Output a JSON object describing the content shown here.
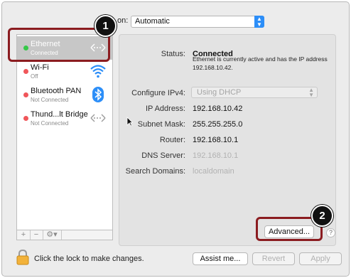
{
  "location": {
    "label_fragment": "on:",
    "value": "Automatic"
  },
  "sidebar": {
    "items": [
      {
        "name": "Ethernet",
        "status": "Connected",
        "dot": "green",
        "icon": "ethernet-arrows-icon"
      },
      {
        "name": "Wi-Fi",
        "status": "Off",
        "dot": "red",
        "icon": "wifi-icon"
      },
      {
        "name": "Bluetooth PAN",
        "status": "Not Connected",
        "dot": "red",
        "icon": "bluetooth-icon"
      },
      {
        "name": "Thund...lt Bridge",
        "status": "Not Connected",
        "dot": "red",
        "icon": "bridge-arrows-icon"
      }
    ],
    "bottom": {
      "add": "+",
      "remove": "−",
      "gear": "⚙▾"
    }
  },
  "details": {
    "status_label": "Status:",
    "status_value": "Connected",
    "status_desc": "Ethernet is currently active and has the IP address 192.168.10.42.",
    "configure_label": "Configure IPv4:",
    "configure_value": "Using DHCP",
    "ip_label": "IP Address:",
    "ip_value": "192.168.10.42",
    "subnet_label": "Subnet Mask:",
    "subnet_value": "255.255.255.0",
    "router_label": "Router:",
    "router_value": "192.168.10.1",
    "dns_label": "DNS Server:",
    "dns_value": "192.168.10.1",
    "search_label": "Search Domains:",
    "search_value": "localdomain",
    "advanced_button": "Advanced...",
    "help_button": "?"
  },
  "footer": {
    "lock_text": "Click the lock to make changes.",
    "assist_button": "Assist me...",
    "revert_button": "Revert",
    "apply_button": "Apply"
  },
  "annotations": {
    "badge1": "1",
    "badge2": "2"
  },
  "colors": {
    "accent": "#2c8ef8",
    "callout": "#8b1c20",
    "connected": "#35c848",
    "disconnected": "#f0565a"
  }
}
